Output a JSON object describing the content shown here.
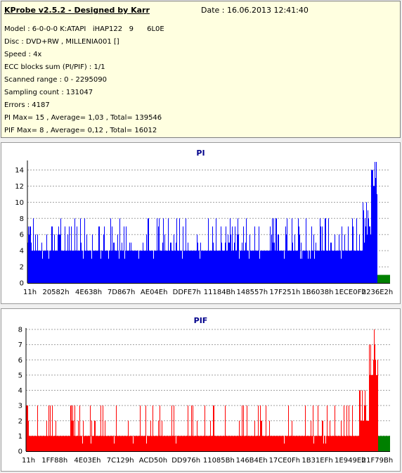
{
  "info": {
    "title": "KProbe v2.5.2 - Designed by Karr",
    "date": "Date : 16.06.2013 12:41:40",
    "lines": [
      "Model : 6-0-0-0 K:ATAPI   iHAP122   9      6L0E",
      "Disc : DVD+RW , MILLENIA001 []",
      "Speed : 4x",
      "ECC blocks sum (PI/PIF) : 1/1",
      "Scanned range : 0 - 2295090",
      "Sampling count : 131047",
      "Errors : 4187",
      "PI Max= 15 , Average= 1,03 , Total= 139546",
      "PIF Max= 8 , Average= 0,12 , Total= 16012"
    ]
  },
  "chart_data": [
    {
      "type": "bar",
      "title": "PI",
      "color": "#0000ff",
      "marker_color": "#008000",
      "ylim": [
        0,
        15
      ],
      "yticks": [
        0,
        2,
        4,
        6,
        8,
        10,
        12,
        14
      ],
      "xticks": [
        "11h",
        "20582h",
        "4E638h",
        "7D867h",
        "AE04Eh",
        "DDFE7h",
        "11184Bh",
        "148557h",
        "17F251h",
        "1B6038h",
        "1ECE0Fh",
        "2236E2h"
      ],
      "grid": true,
      "max": 15,
      "average": 1.03,
      "baseline": 4,
      "spike_values": [
        5,
        6,
        7,
        8
      ]
    },
    {
      "type": "bar",
      "title": "PIF",
      "color": "#ff0000",
      "marker_color": "#008000",
      "ylim": [
        0,
        8
      ],
      "yticks": [
        0,
        1,
        2,
        3,
        4,
        5,
        6,
        7,
        8
      ],
      "xticks": [
        "11h",
        "1FF88h",
        "4E03Eh",
        "7C129h",
        "ACD50h",
        "DD976h",
        "11085Bh",
        "146B4Eh",
        "17CE0Fh",
        "1B31EFh",
        "1E949Eh",
        "21F79Bh"
      ],
      "grid": true,
      "max": 8,
      "average": 0.12,
      "baseline": 1,
      "spike_values": [
        2,
        3
      ]
    }
  ]
}
